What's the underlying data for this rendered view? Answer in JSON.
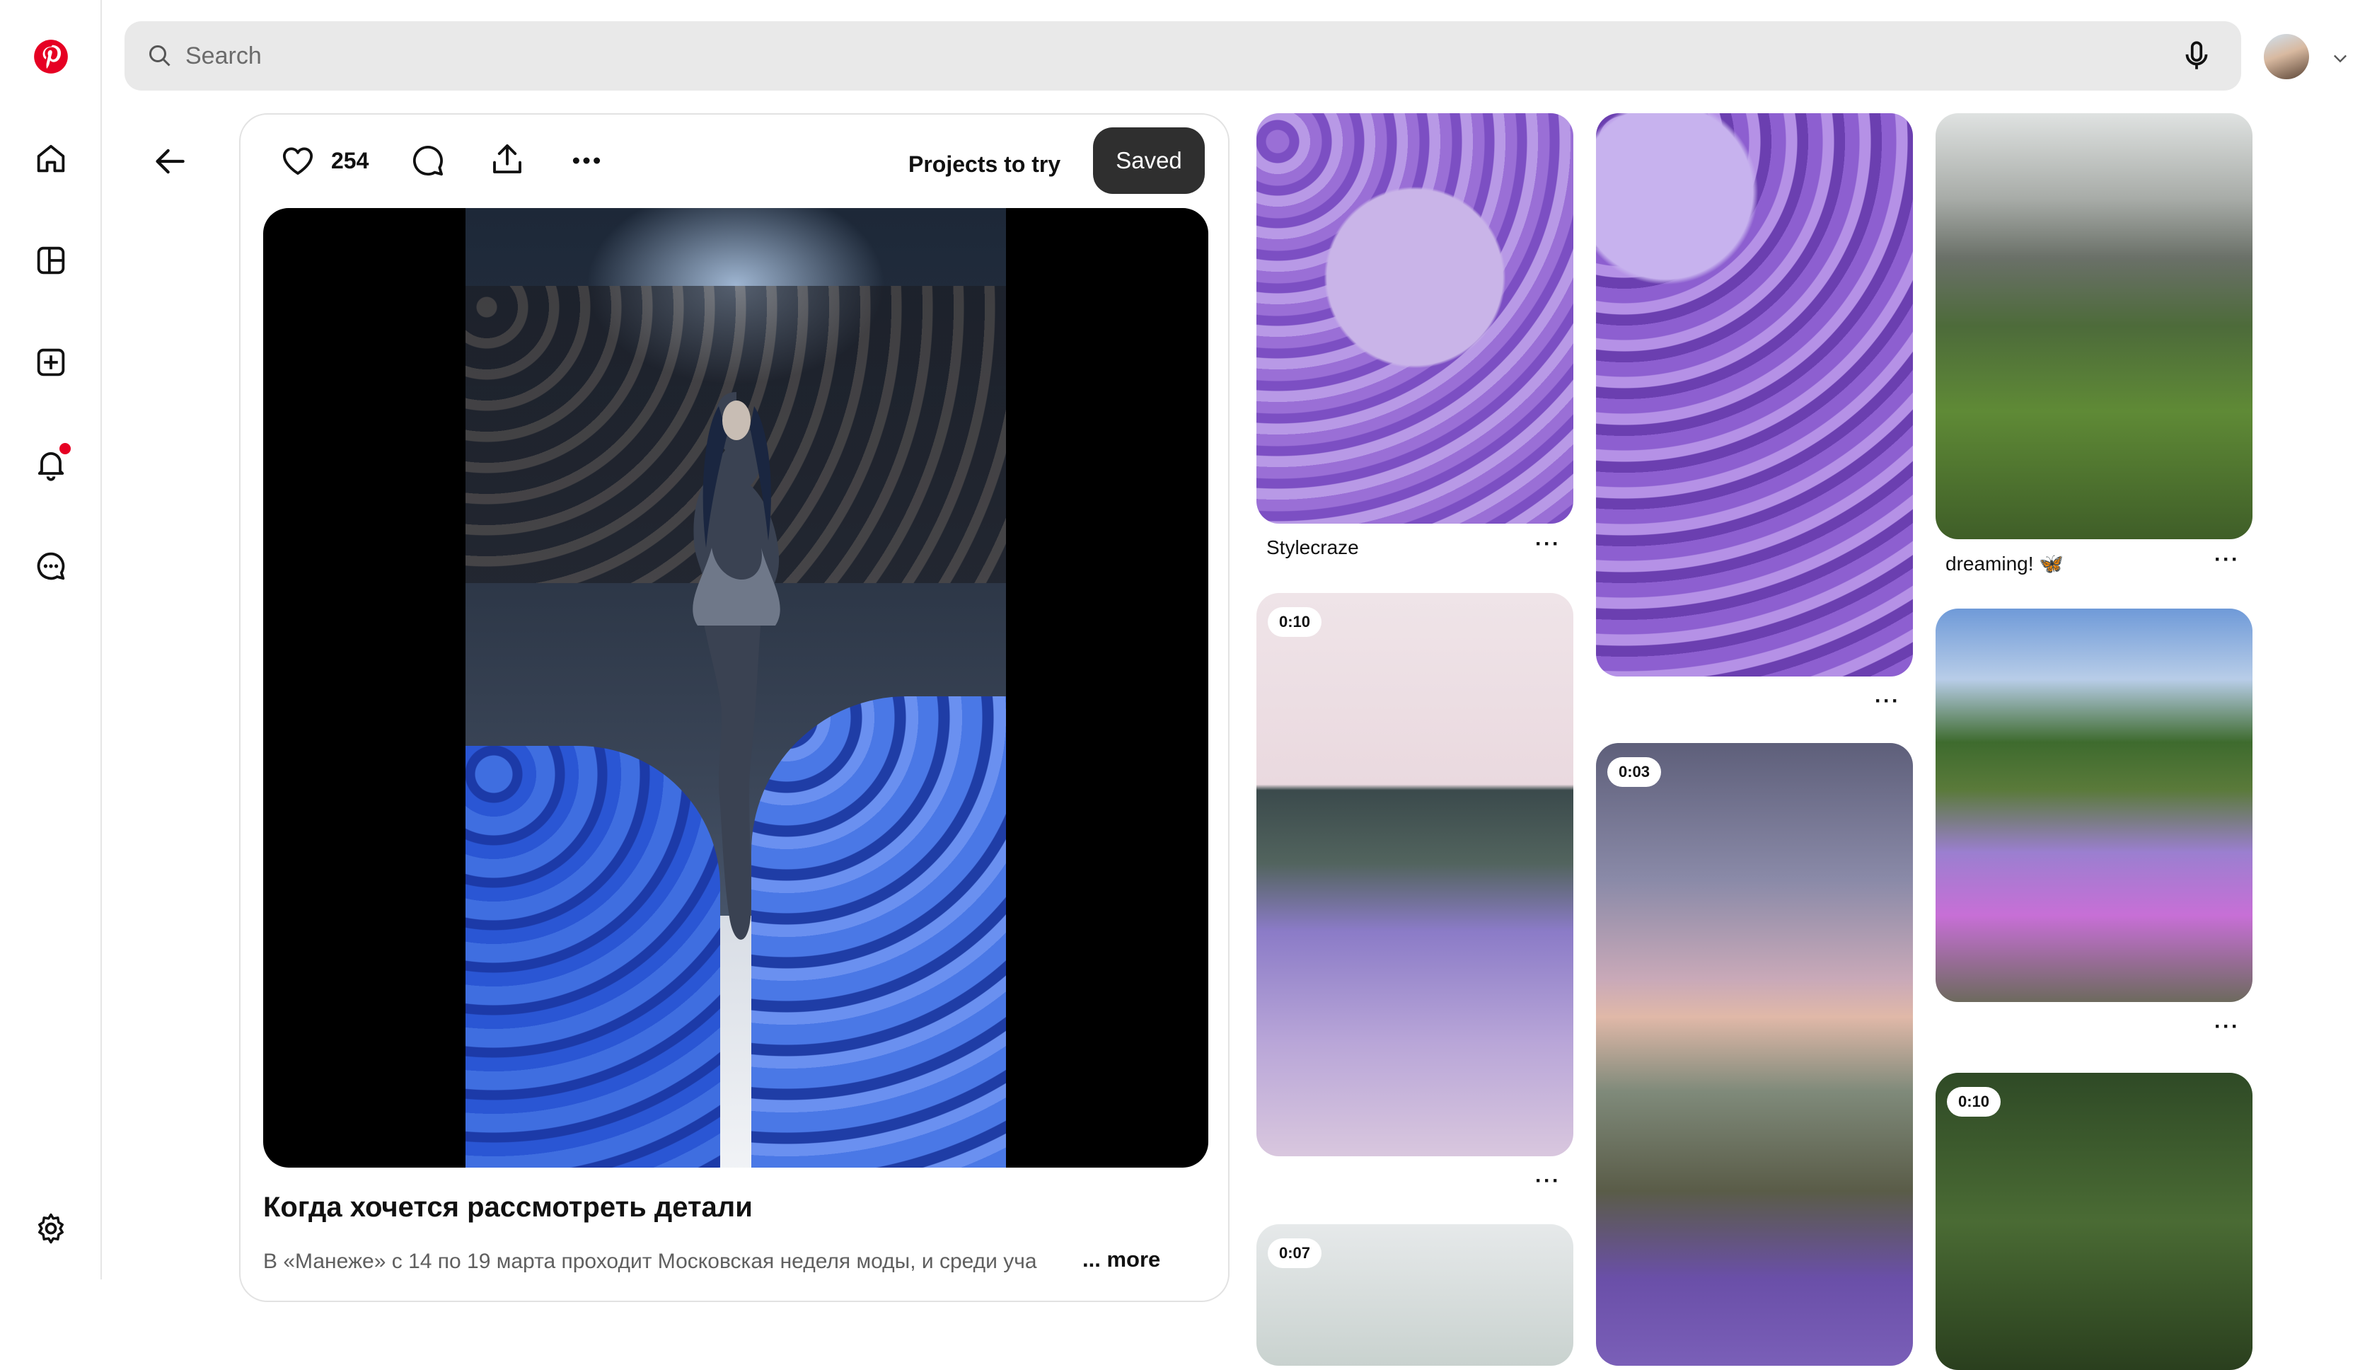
{
  "search": {
    "placeholder": "Search"
  },
  "pin": {
    "like_count": "254",
    "projects_label": "Projects to try",
    "saved_label": "Saved",
    "title": "Когда хочется рассмотреть детали",
    "description": "В «Манеже» с 14 по 19 марта проходит Московская неделя моды, и среди уча",
    "more_label": "... more"
  },
  "grid": {
    "col1": [
      {
        "caption": "Stylecraze",
        "badge": ""
      },
      {
        "caption": "",
        "badge": "0:10"
      },
      {
        "caption": "",
        "badge": "0:07"
      }
    ],
    "col2": [
      {
        "caption": "",
        "badge": ""
      },
      {
        "caption": "",
        "badge": "0:03"
      }
    ],
    "col3": [
      {
        "caption": "dreaming! 🦋",
        "badge": ""
      },
      {
        "caption": "",
        "badge": ""
      },
      {
        "caption": "",
        "badge": "0:10"
      }
    ]
  },
  "more_dots": "···",
  "colors": {
    "brand": "#e60023",
    "saved_btn": "#2f2f2f",
    "search_bg": "#e9e9e9"
  }
}
